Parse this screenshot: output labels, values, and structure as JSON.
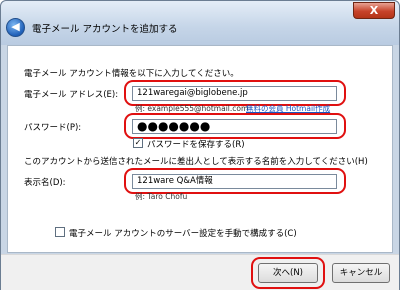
{
  "window": {
    "title": "電子メール アカウントを追加する",
    "back_glyph": "◀",
    "close_glyph": "X"
  },
  "form": {
    "instruction": "電子メール アカウント情報を以下に入力してください。",
    "email_label": "電子メール アドレス(E):",
    "email_value": "121waregai@biglobene.jp",
    "email_example": "例: example555@hotmail.com",
    "email_link": "無料の会員 Hotmail作成",
    "password_label": "パスワード(P):",
    "password_value": "●●●●●●●",
    "save_password_label": "パスワードを保存する(R)",
    "save_password_checked": "✓",
    "display_instruction": "このアカウントから送信されたメールに差出人として表示する名前を入力してください(H)",
    "display_label": "表示名(D):",
    "display_value": "121ware Q&A情報",
    "display_example": "例: Taro Chofu",
    "manual_config_label": "電子メール アカウントのサーバー設定を手動で構成する(C)"
  },
  "buttons": {
    "next": "次へ(N)",
    "cancel": "キャンセル"
  },
  "colors": {
    "highlight": "#e01010",
    "link": "#1a55c0"
  }
}
